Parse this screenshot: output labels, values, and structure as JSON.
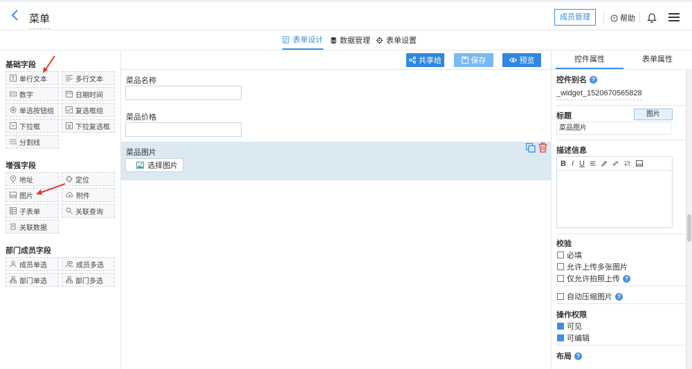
{
  "header": {
    "title": "菜单",
    "member_button": "成员管理",
    "help_label": "帮助"
  },
  "tabs": [
    "表单设计",
    "数据管理",
    "表单设置"
  ],
  "left": {
    "basic_title": "基础字段",
    "basic": [
      "单行文本",
      "多行文本",
      "数字",
      "日期时间",
      "单选按钮组",
      "复选框组",
      "下拉框",
      "下拉复选框",
      "分割线"
    ],
    "enhanced_title": "增强字段",
    "enhanced": [
      "地址",
      "定位",
      "图片",
      "附件",
      "子表单",
      "关联查询",
      "关联数据"
    ],
    "dept_title": "部门成员字段",
    "dept": [
      "成员单选",
      "成员多选",
      "部门单选",
      "部门多选"
    ]
  },
  "center": {
    "share_button": "共享给",
    "save_button": "保存",
    "preview_button": "预览",
    "fields": [
      {
        "label": "菜品名称"
      },
      {
        "label": "菜品价格"
      }
    ],
    "selected_field": {
      "label": "菜品图片",
      "button": "选择图片"
    }
  },
  "right": {
    "tab_widget": "控件属性",
    "tab_form": "表单属性",
    "alias_title": "控件别名",
    "alias_value": "_widget_1520670565828",
    "label_title": "标题",
    "label_type_button": "图片",
    "label_value": "菜品图片",
    "desc_title": "描述信息",
    "editor_tools": [
      "B",
      "I",
      "U"
    ],
    "validate_title": "校验",
    "checks": [
      {
        "label": "必填",
        "checked": false
      },
      {
        "label": "允许上传多张图片",
        "checked": false
      },
      {
        "label": "仅允许拍照上传",
        "checked": false
      }
    ],
    "compress_label": "自动压缩图片",
    "compress_checked": false,
    "perm_title": "操作权限",
    "perms": [
      {
        "label": "可见",
        "checked": true
      },
      {
        "label": "可编辑",
        "checked": true
      }
    ],
    "layout_title": "布局"
  }
}
